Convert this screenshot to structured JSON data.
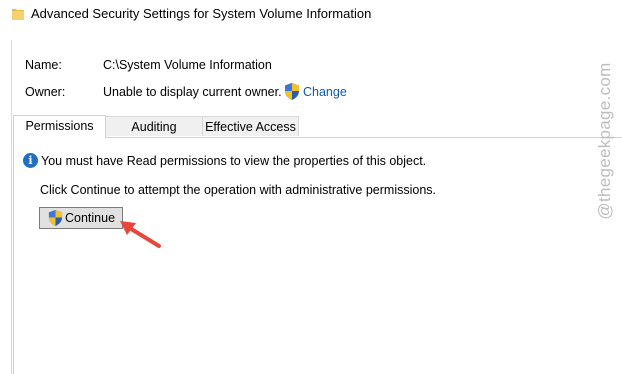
{
  "window": {
    "title": "Advanced Security Settings for System Volume Information",
    "title_icon": "folder-icon"
  },
  "fields": {
    "name_label": "Name:",
    "name_value": "C:\\System Volume Information",
    "owner_label": "Owner:",
    "owner_value": "Unable to display current owner.",
    "owner_icon": "uac-shield-icon",
    "change_link": "Change"
  },
  "tabs": [
    {
      "label": "Permissions",
      "active": true
    },
    {
      "label": "Auditing",
      "active": false
    },
    {
      "label": "Effective Access",
      "active": false
    }
  ],
  "content": {
    "info_icon": "info-icon",
    "info_text": "You must have Read permissions to view the properties of this object.",
    "hint_text": "Click Continue to attempt the operation with administrative permissions.",
    "continue_button": "Continue"
  },
  "watermark": {
    "text": "@thegeekpage.com"
  },
  "annotation": {
    "arrow_color": "#e8453c",
    "icon": "red-arrow-icon"
  },
  "colors": {
    "link": "#0b5cad",
    "info_blue": "#1f6fc5",
    "button_face": "#e1e1e1",
    "arrow": "#e8453c",
    "watermark": "#bdbdbd"
  }
}
